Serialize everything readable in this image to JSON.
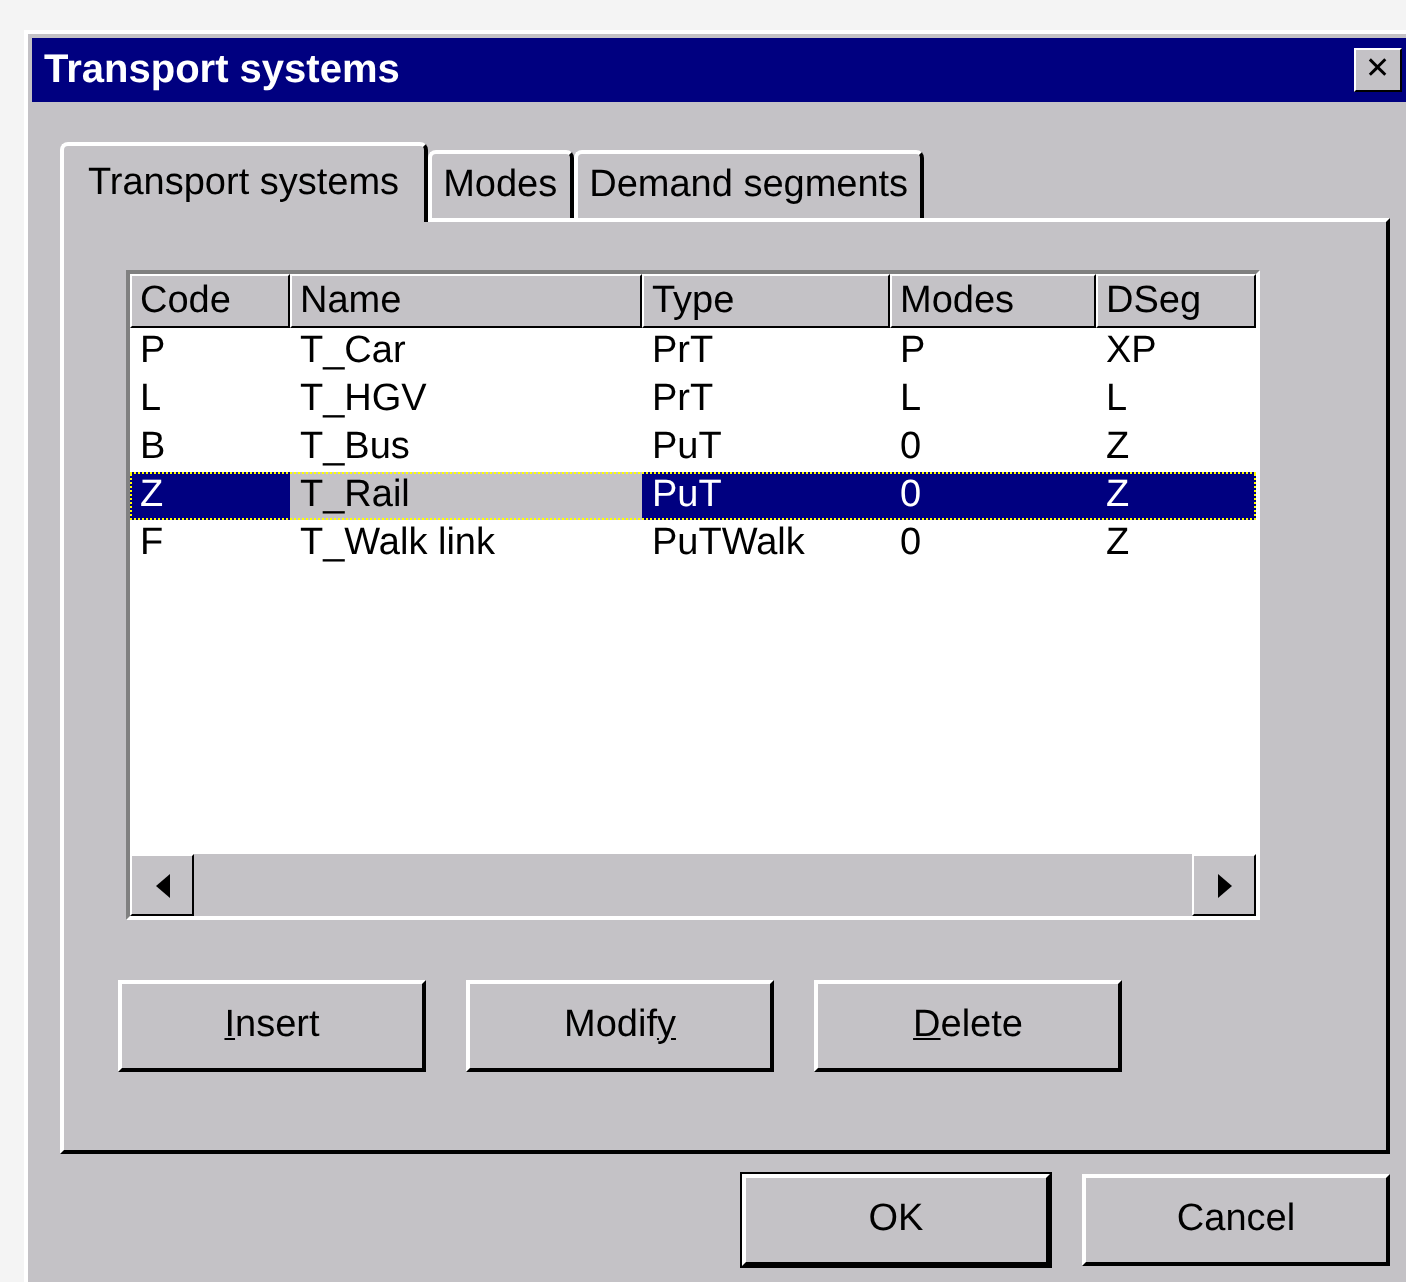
{
  "window": {
    "title": "Transport systems",
    "close": "✕"
  },
  "tabs": [
    {
      "label": "Transport systems",
      "selected": true
    },
    {
      "label": "Modes",
      "selected": false
    },
    {
      "label": "Demand segments",
      "selected": false
    }
  ],
  "table": {
    "columns": [
      {
        "label": "Code",
        "selected": false
      },
      {
        "label": "Name",
        "selected": true
      },
      {
        "label": "Type",
        "selected": false
      },
      {
        "label": "Modes",
        "selected": false
      },
      {
        "label": "DSeg",
        "selected": false
      }
    ],
    "rows": [
      {
        "cells": [
          "P",
          "T_Car",
          "PrT",
          "P",
          "XP"
        ],
        "selected": false
      },
      {
        "cells": [
          "L",
          "T_HGV",
          "PrT",
          "L",
          "L"
        ],
        "selected": false
      },
      {
        "cells": [
          "B",
          "T_Bus",
          "PuT",
          "0",
          "Z"
        ],
        "selected": false
      },
      {
        "cells": [
          "Z",
          "T_Rail",
          "PuT",
          "0",
          "Z"
        ],
        "selected": true
      },
      {
        "cells": [
          "F",
          "T_Walk link",
          "PuTWalk",
          "0",
          "Z"
        ],
        "selected": false
      }
    ]
  },
  "actions": [
    {
      "access_key": "I",
      "text_after": "nsert"
    },
    {
      "text_before": "Modif",
      "access_key": "y"
    },
    {
      "access_key": "D",
      "text_after": "elete"
    }
  ],
  "buttons": [
    {
      "label": "OK",
      "default": true
    },
    {
      "label": "Cancel",
      "default": false
    }
  ]
}
